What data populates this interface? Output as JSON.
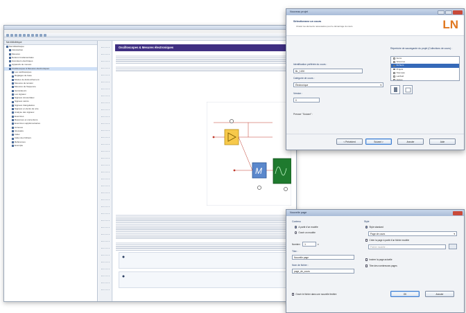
{
  "main": {
    "doc_title": "Oscilloscopes & Mesures électroniques",
    "tree_header": "Ma bibliothèque",
    "tree_items": [
      "Ma bibliothèque",
      "Introduction",
      "Mesures",
      "Notions fondamentales",
      "Grandeurs électriques",
      "Appareils de mesure",
      "Oscilloscopes & Mesures électroniques",
      "Les oscilloscopes",
      "Réglages de base",
      "Modes de déclenchement",
      "Mesures de tension",
      "Mesures de fréquence",
      "Générateurs",
      "Les signaux",
      "Signaux sinusoïdaux",
      "Signaux carrés",
      "Signaux triangulaires",
      "Signaux en dents de scie",
      "Analyse des signaux",
      "Exercices",
      "Réponses et corrections",
      "Exercices supplémentaires",
      "Annexes",
      "Glossaire",
      "Index",
      "Index des fichiers",
      "Références",
      "Exemple"
    ]
  },
  "dialog1": {
    "title": "Nouveau projet",
    "heading": "Sélectionnez un cours",
    "subheading": "Choisir les éléments nécessaires pour le démarrage du cours",
    "logo": "LN",
    "id_label": "Identification préférée du cours :",
    "id_value": "BL_1200",
    "category_label": "Catégorie de cours :",
    "category_value": "Électronique",
    "version_label": "Version :",
    "version_value": "0",
    "list_label": "Répertoire de sauvegarde du projet (Collections de cours) :",
    "list_items": [
      "Items",
      "Sciences",
      "Fichiers",
      "Projets",
      "Nouveau",
      "LabSoft",
      "Autres"
    ],
    "list_selected": 2,
    "prompt": "Presser \"Suivant\" :",
    "buttons": [
      "< Précédent",
      "Suivant >",
      "Annuler",
      "Aide"
    ]
  },
  "dialog2": {
    "title": "Nouvelle page",
    "left_group": "Contenu",
    "radio1": "A partir d'un modèle",
    "radio2": "Ouvrir un modèle",
    "count_label": "Nombre :",
    "count_value": "1",
    "title_label": "Titre :",
    "title_value": "Nouvelle page",
    "file_label": "Nom de fichier :",
    "file_value": "page_de_cours",
    "right_group": "Style",
    "style_radio": "Style standard",
    "style_value": "Page de cours",
    "style_check": "Créer la page à partir d'un fichier modèle",
    "browse_label": "Fichier modèle ...",
    "check2": "Insérer la page actuelle",
    "check3": "Titre des nombreuses pages",
    "bottom_check": "Ouvrir le fichier dans une nouvelle fenêtre",
    "ok": "OK",
    "cancel": "Annuler"
  }
}
